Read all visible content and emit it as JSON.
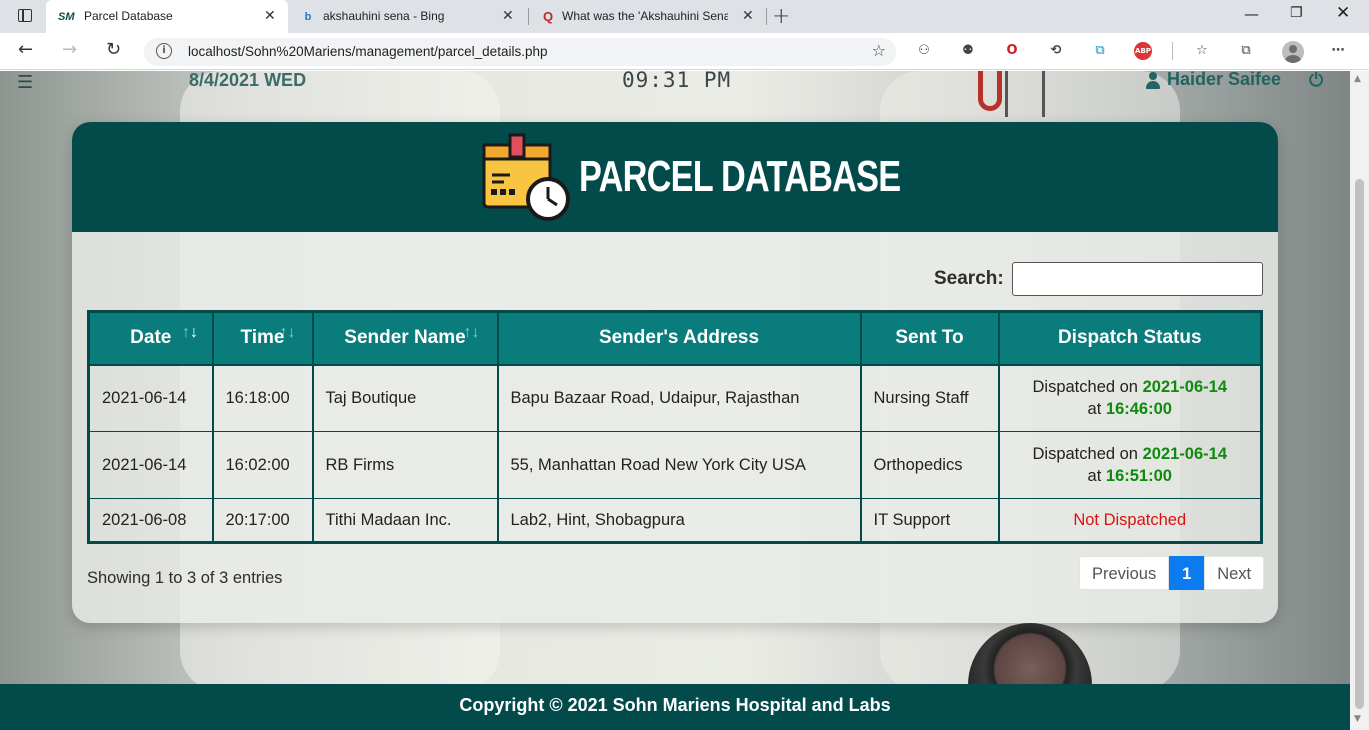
{
  "browser": {
    "tabs": [
      {
        "favicon": "SM",
        "title": "Parcel Database",
        "active": true
      },
      {
        "favicon": "b",
        "title": "akshauhini sena - Bing",
        "active": false
      },
      {
        "favicon": "Q",
        "title": "What was the 'Akshauhini Sena' (",
        "active": false
      }
    ],
    "url": "localhost/Sohn%20Mariens/management/parcel_details.php"
  },
  "topbar": {
    "date": "8/4/2021 WED",
    "time": "09:31 PM",
    "user": "Haider Saifee"
  },
  "card": {
    "title": "PARCEL DATABASE",
    "search_label": "Search:",
    "search_value": ""
  },
  "table": {
    "headers": [
      "Date",
      "Time",
      "Sender Name",
      "Sender's Address",
      "Sent To",
      "Dispatch Status"
    ],
    "rows": [
      {
        "date": "2021-06-14",
        "time": "16:18:00",
        "sender": "Taj Boutique",
        "address": "Bapu Bazaar Road, Udaipur, Rajasthan",
        "sent_to": "Nursing Staff",
        "status": {
          "prefix": "Dispatched on",
          "date": "2021-06-14",
          "at": "at",
          "time": "16:46:00"
        }
      },
      {
        "date": "2021-06-14",
        "time": "16:02:00",
        "sender": "RB Firms",
        "address": "55, Manhattan Road New York City USA",
        "sent_to": "Orthopedics",
        "status": {
          "prefix": "Dispatched on",
          "date": "2021-06-14",
          "at": "at",
          "time": "16:51:00"
        }
      },
      {
        "date": "2021-06-08",
        "time": "20:17:00",
        "sender": "Tithi Madaan Inc.",
        "address": "Lab2, Hint, Shobagpura",
        "sent_to": "IT Support",
        "status": {
          "text": "Not Dispatched"
        }
      }
    ]
  },
  "pagination": {
    "info": "Showing 1 to 3 of 3 entries",
    "previous": "Previous",
    "current": "1",
    "next": "Next"
  },
  "footer": {
    "text": "Copyright © 2021 Sohn Mariens Hospital and Labs"
  },
  "colors": {
    "primary_dark": "#034a4a",
    "table_header": "#0a7c7c",
    "dispatched": "#0f8a0f",
    "not_dispatched": "#dd1111",
    "page_active": "#0d7bf0"
  }
}
